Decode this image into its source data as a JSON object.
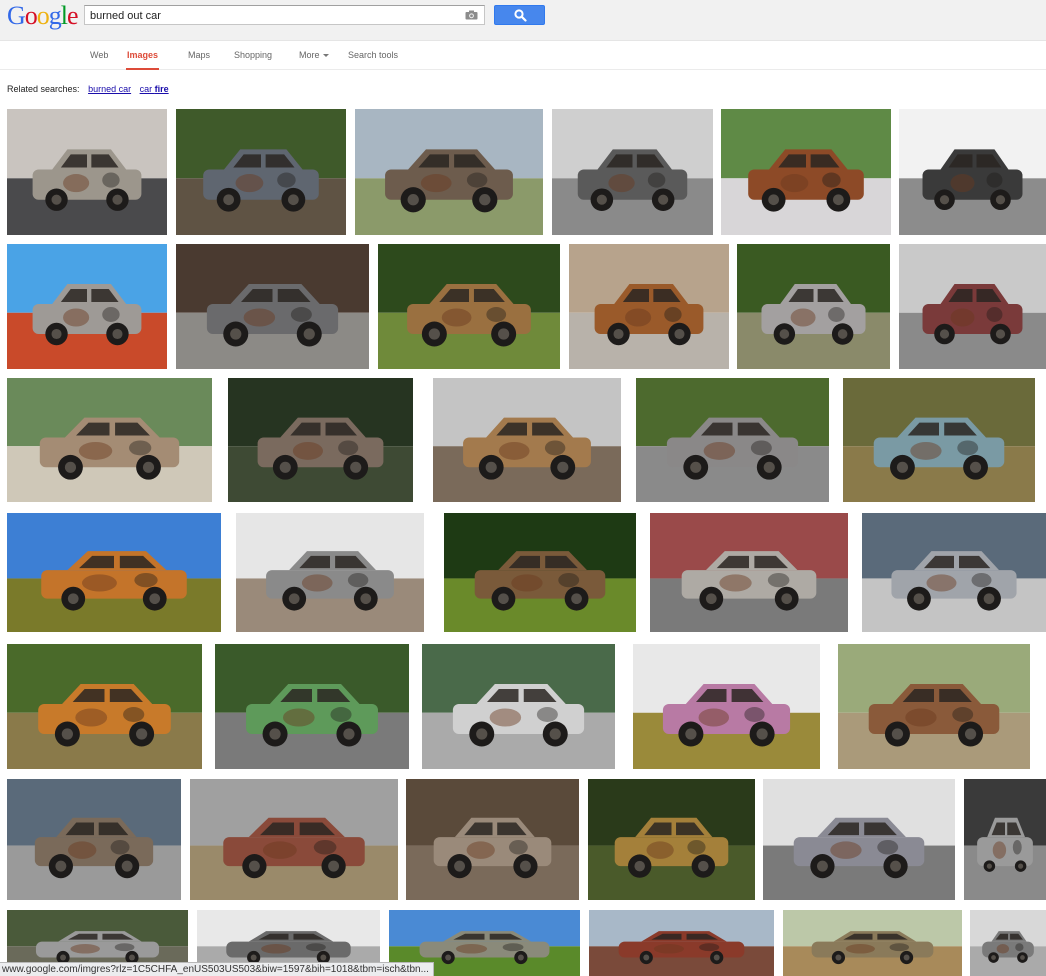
{
  "logo": {
    "letters": [
      {
        "ch": "G",
        "color": "#3369e8"
      },
      {
        "ch": "o",
        "color": "#d50f25"
      },
      {
        "ch": "o",
        "color": "#eeb211"
      },
      {
        "ch": "g",
        "color": "#3369e8"
      },
      {
        "ch": "l",
        "color": "#009925"
      },
      {
        "ch": "e",
        "color": "#d50f25"
      }
    ]
  },
  "search": {
    "query": "burned out car",
    "camera_icon": "camera-icon",
    "button_icon": "magnifier-icon"
  },
  "nav": {
    "items": [
      {
        "label": "Web",
        "active": false
      },
      {
        "label": "Images",
        "active": true
      },
      {
        "label": "Maps",
        "active": false
      },
      {
        "label": "Shopping",
        "active": false
      },
      {
        "label": "More",
        "active": false,
        "dropdown": true
      },
      {
        "label": "Search tools",
        "active": false
      }
    ]
  },
  "related": {
    "label": "Related searches:",
    "links": [
      {
        "prefix": "burned car",
        "bold": ""
      },
      {
        "prefix": "car ",
        "bold": "fire"
      }
    ]
  },
  "status_url": "www.google.com/imgres?rlz=1C5CHFA_enUS503US503&biw=1597&bih=1018&tbm=isch&tbn...",
  "theme": {
    "accent_red": "#dd4b39",
    "link_blue": "#1a0dab",
    "button_blue": "#4787ed"
  },
  "image_rows": [
    [
      {
        "sky": "#c9c4bf",
        "ground": "#4a4a4c",
        "car": "#9c968c"
      },
      {
        "sky": "#3f5a2a",
        "ground": "#5f5344",
        "car": "#5f6670"
      },
      {
        "sky": "#a8b6c2",
        "ground": "#8b9a6a",
        "car": "#6d5c4d"
      },
      {
        "sky": "#cfcfcf",
        "ground": "#8a8a8a",
        "car": "#5a5a5a"
      },
      {
        "sky": "#5f8a46",
        "ground": "#d8d6d8",
        "car": "#8d4a27"
      },
      {
        "sky": "#f2f2f2",
        "ground": "#8c8c8c",
        "car": "#3a3a3a"
      }
    ],
    [
      {
        "sky": "#4aa3e6",
        "ground": "#c94a2a",
        "car": "#9e9a96"
      },
      {
        "sky": "#4a3a30",
        "ground": "#8c8a86",
        "car": "#6a6a6c"
      },
      {
        "sky": "#2d4a1c",
        "ground": "#6f8a3a",
        "car": "#9a7040"
      },
      {
        "sky": "#b7a38c",
        "ground": "#b8b2aa",
        "car": "#9a5a2a"
      },
      {
        "sky": "#3a5a22",
        "ground": "#8a8a6a",
        "car": "#a3a0a0"
      },
      {
        "sky": "#c9c9c9",
        "ground": "#8a8a8a",
        "car": "#7a3a3a"
      }
    ],
    [
      {
        "sky": "#6a8a5a",
        "ground": "#cfc8b8",
        "car": "#a48c74"
      },
      {
        "sky": "#263421",
        "ground": "#3e4a34",
        "car": "#7a6a5e"
      },
      {
        "sky": "#c4c4c4",
        "ground": "#7a6a5a",
        "car": "#a37a4d"
      },
      {
        "sky": "#4d6a2e",
        "ground": "#8a8a8a",
        "car": "#8a8888"
      },
      {
        "sky": "#6a6a3a",
        "ground": "#8a7a4a",
        "car": "#7a9aa4"
      }
    ],
    [
      {
        "sky": "#3d7fd4",
        "ground": "#7a7a2a",
        "car": "#c4742a"
      },
      {
        "sky": "#e6e6e6",
        "ground": "#9a8a7a",
        "car": "#8a8a8a"
      },
      {
        "sky": "#1e3a14",
        "ground": "#6a8a2a",
        "car": "#7a5a3a"
      },
      {
        "sky": "#9a4a4a",
        "ground": "#7a7a7a",
        "car": "#aeaaa4"
      },
      {
        "sky": "#5a6a7a",
        "ground": "#c4c4c4",
        "car": "#a0a4aa"
      }
    ],
    [
      {
        "sky": "#4a6a2a",
        "ground": "#8a7a4a",
        "car": "#c87a2a"
      },
      {
        "sky": "#3a5a2a",
        "ground": "#7a7a7a",
        "car": "#5e9a5a"
      },
      {
        "sky": "#4a6a4a",
        "ground": "#aaaaaa",
        "car": "#d0d0d0"
      },
      {
        "sky": "#e8e8e8",
        "ground": "#9a8a3a",
        "car": "#b87aa4"
      },
      {
        "sky": "#9aaa7a",
        "ground": "#aa9a7a",
        "car": "#8a5a3a"
      }
    ],
    [
      {
        "sky": "#5a6a7a",
        "ground": "#9a9a9a",
        "car": "#7a6a5a"
      },
      {
        "sky": "#a0a0a0",
        "ground": "#9a8a6a",
        "car": "#8a4a3a"
      },
      {
        "sky": "#5a4a3a",
        "ground": "#7a6a5a",
        "car": "#9a8a7a"
      },
      {
        "sky": "#2a3a1a",
        "ground": "#4a5a2a",
        "car": "#a4803a"
      },
      {
        "sky": "#e0e0e0",
        "ground": "#7a7a7a",
        "car": "#8a8a94"
      },
      {
        "sky": "#3a3a3a",
        "ground": "#8a8a8a",
        "car": "#9a9a9a"
      }
    ],
    [
      {
        "sky": "#4a5a3a",
        "ground": "#6a6a5a",
        "car": "#9a9a9a"
      },
      {
        "sky": "#e8e8e8",
        "ground": "#aaaaaa",
        "car": "#6a6a6a"
      },
      {
        "sky": "#4a8ad4",
        "ground": "#5a8a2a",
        "car": "#8a8a7a"
      },
      {
        "sky": "#a8b8c8",
        "ground": "#7a4a3a",
        "car": "#8a3a2a"
      },
      {
        "sky": "#bcc8a8",
        "ground": "#a88a5a",
        "car": "#8a7a5a"
      },
      {
        "sky": "#d8d8d8",
        "ground": "#aaaaaa",
        "car": "#7a7a7a"
      }
    ]
  ]
}
